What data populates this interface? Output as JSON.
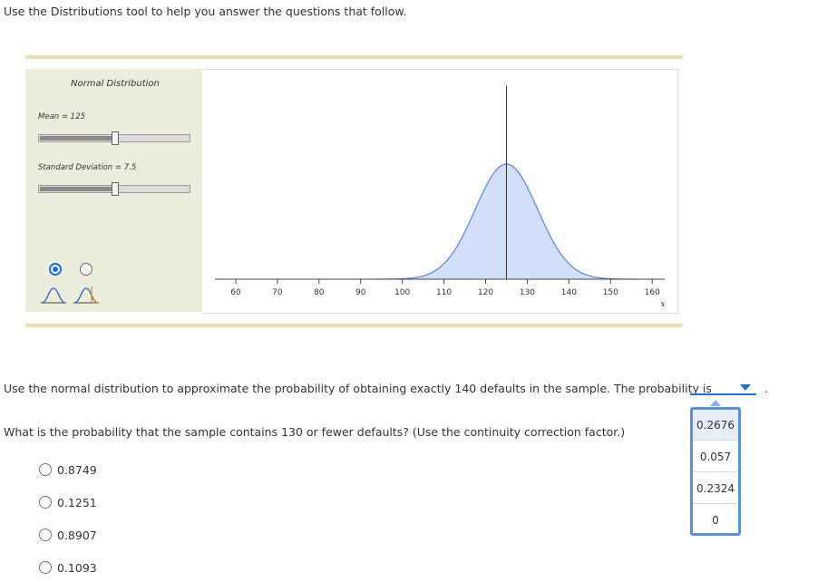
{
  "instruction": "Use the Distributions tool to help you answer the questions that follow.",
  "tool": {
    "panel_title": "Normal Distribution",
    "mean_label": "Mean = 125",
    "sd_label": "Standard Deviation = 7.5",
    "mean_slider_fraction": 0.5,
    "sd_slider_fraction": 0.5,
    "selected_mode": 0,
    "x_axis_label": "x"
  },
  "chart_data": {
    "type": "area",
    "distribution": "normal",
    "mean": 125,
    "sd": 7.5,
    "xlim": [
      55,
      163
    ],
    "x_ticks": [
      60,
      70,
      80,
      90,
      100,
      110,
      120,
      130,
      140,
      150,
      160
    ],
    "xlabel": "x",
    "vertical_line_x": 125,
    "fill_color": "#d3defa",
    "line_color": "#5a84d1"
  },
  "question1": {
    "text": "Use the normal distribution to approximate the probability of obtaining exactly 140 defaults in the sample. The probability is",
    "trailing": ".",
    "dropdown_options": [
      "0.2676",
      "0.057",
      "0.2324",
      "0"
    ],
    "highlighted_option": 0
  },
  "question2": {
    "text": "What is the probability that the sample contains 130 or fewer defaults? (Use the continuity correction factor.)",
    "choices": [
      "0.8749",
      "0.1251",
      "0.8907",
      "0.1093"
    ]
  },
  "colors": {
    "accent": "#1f6fd6",
    "panel_bg": "#eceddd",
    "rule": "#e8dfb5"
  }
}
